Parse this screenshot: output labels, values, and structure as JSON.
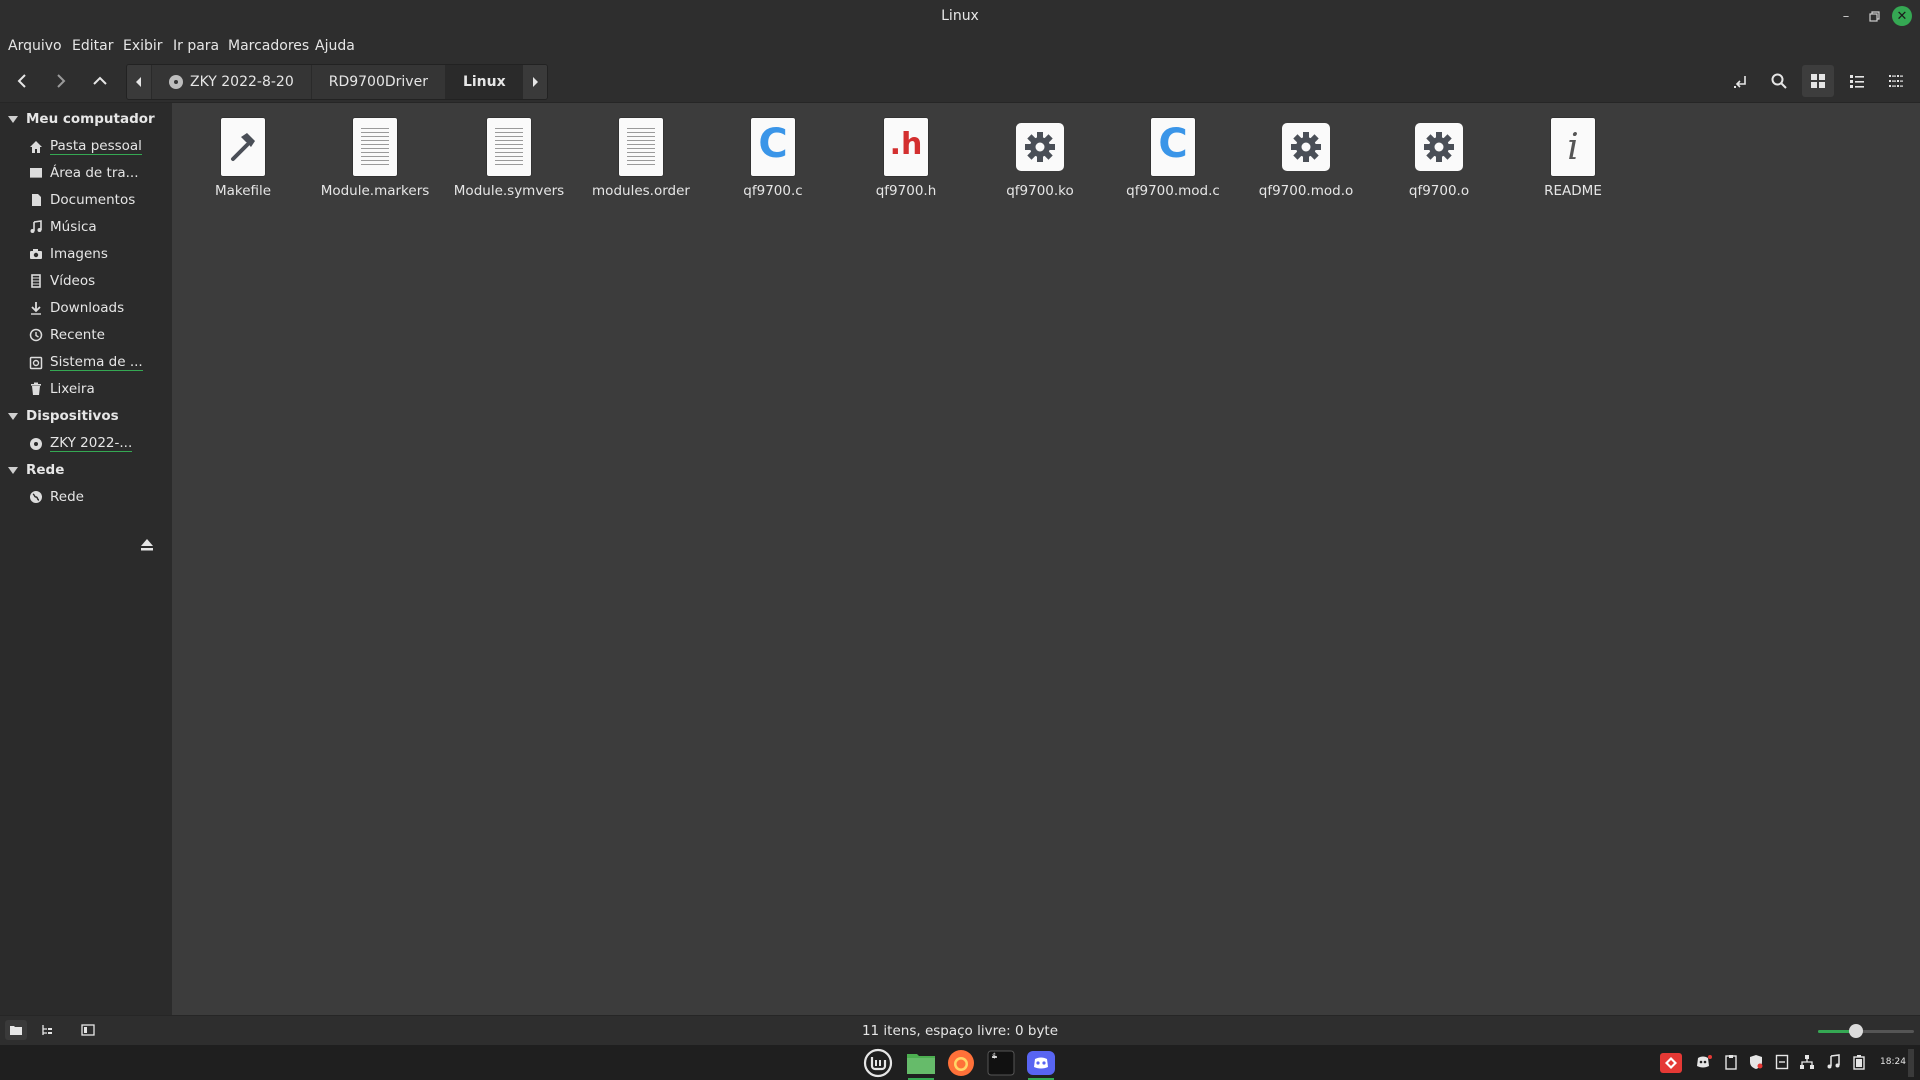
{
  "window": {
    "title": "Linux"
  },
  "menu": [
    "Arquivo",
    "Editar",
    "Exibir",
    "Ir para",
    "Marcadores",
    "Ajuda"
  ],
  "breadcrumbs": [
    {
      "label": "ZKY 2022-8-20",
      "icon": "disc-icon"
    },
    {
      "label": "RD9700Driver"
    },
    {
      "label": "Linux",
      "active": true
    }
  ],
  "sidebar": {
    "sections": [
      {
        "title": "Meu computador",
        "items": [
          {
            "label": "Pasta pessoal",
            "icon": "home-icon"
          },
          {
            "label": "Área de tra...",
            "icon": "desktop-icon"
          },
          {
            "label": "Documentos",
            "icon": "document-icon"
          },
          {
            "label": "Música",
            "icon": "music-icon"
          },
          {
            "label": "Imagens",
            "icon": "camera-icon"
          },
          {
            "label": "Vídeos",
            "icon": "film-icon"
          },
          {
            "label": "Downloads",
            "icon": "download-icon"
          },
          {
            "label": "Recente",
            "icon": "clock-icon"
          },
          {
            "label": "Sistema de ...",
            "icon": "drive-icon"
          },
          {
            "label": "Lixeira",
            "icon": "trash-icon"
          }
        ]
      },
      {
        "title": "Dispositivos",
        "items": [
          {
            "label": "ZKY 2022-...",
            "icon": "disc-icon"
          }
        ]
      },
      {
        "title": "Rede",
        "items": [
          {
            "label": "Rede",
            "icon": "network-icon"
          }
        ]
      }
    ]
  },
  "files": [
    {
      "name": "Makefile",
      "icon": "makefile-icon"
    },
    {
      "name": "Module.markers",
      "icon": "text-file-icon"
    },
    {
      "name": "Module.symvers",
      "icon": "text-file-icon"
    },
    {
      "name": "modules.order",
      "icon": "text-file-icon"
    },
    {
      "name": "qf9700.c",
      "icon": "c-source-icon",
      "glyph": "C"
    },
    {
      "name": "qf9700.h",
      "icon": "c-header-icon",
      "glyph": ".h"
    },
    {
      "name": "qf9700.ko",
      "icon": "gear-file-icon"
    },
    {
      "name": "qf9700.mod.c",
      "icon": "c-source-icon",
      "glyph": "C"
    },
    {
      "name": "qf9700.mod.o",
      "icon": "gear-file-icon"
    },
    {
      "name": "qf9700.o",
      "icon": "gear-file-icon"
    },
    {
      "name": "README",
      "icon": "readme-icon",
      "glyph": "i"
    }
  ],
  "status": {
    "text": "11 itens, espaço livre: 0 byte",
    "zoom_fraction": 0.4
  },
  "panel": {
    "clock": "18:24"
  },
  "colors": {
    "accent": "#35a853",
    "c_blue": "#3a95e8",
    "h_red": "#d32f2f"
  }
}
